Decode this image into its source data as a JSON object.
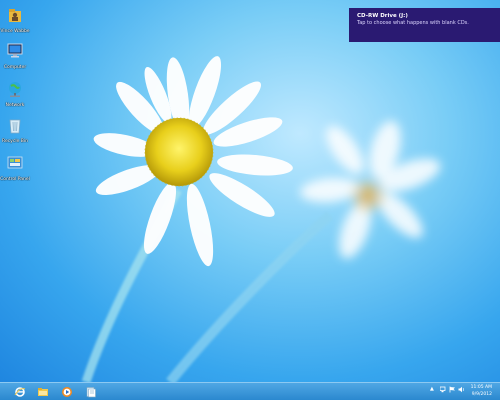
{
  "desktop": {
    "icons": [
      {
        "name": "user-folder-icon",
        "label": "Vince Wabbe"
      },
      {
        "name": "computer-icon",
        "label": "Computer"
      },
      {
        "name": "network-icon",
        "label": "Network"
      },
      {
        "name": "recycle-bin-icon",
        "label": "Recycle Bin"
      },
      {
        "name": "control-panel-icon",
        "label": "Control Panel"
      }
    ]
  },
  "notification": {
    "title": "CD-RW Drive (J:)",
    "body": "Tap to choose what happens with blank CDs."
  },
  "taskbar": {
    "pinned": [
      {
        "name": "internet-explorer-icon"
      },
      {
        "name": "file-explorer-icon"
      },
      {
        "name": "media-player-icon"
      },
      {
        "name": "documents-icon"
      }
    ],
    "tray_icons": [
      "chevron-up-icon",
      "network-status-icon",
      "flag-icon",
      "volume-icon"
    ]
  },
  "clock": {
    "time": "11:05 AM",
    "date": "9/9/2012"
  }
}
